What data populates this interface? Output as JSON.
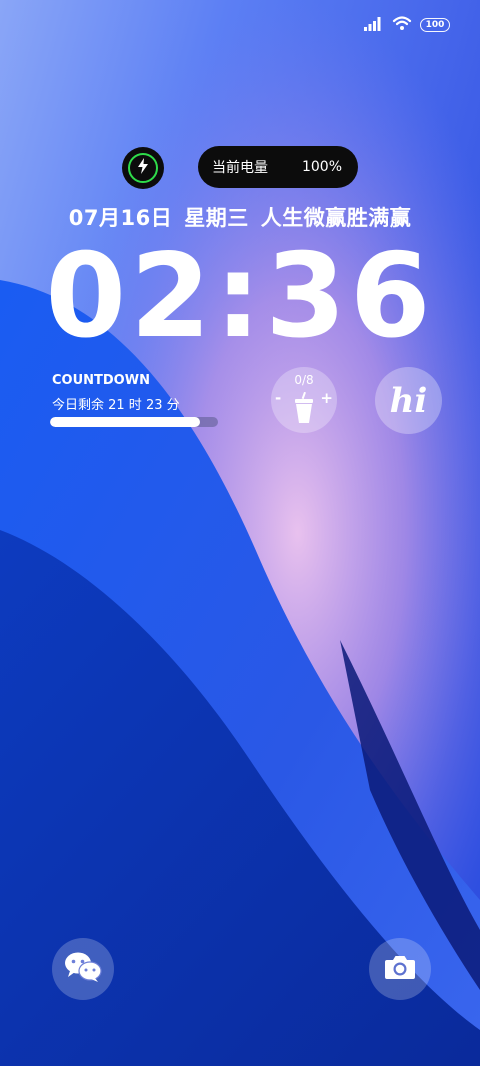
{
  "status_bar": {
    "battery_level": "100",
    "icons": [
      "signal-icon",
      "wifi-icon",
      "battery-icon"
    ]
  },
  "charging": {
    "icon": "lightning-icon",
    "ring_color": "#2fdc4a"
  },
  "battery_capsule": {
    "label": "当前电量",
    "value": "100%"
  },
  "lockscreen": {
    "date": "07月16日",
    "weekday": "星期三",
    "slogan": "人生微赢胜满赢",
    "time": "02:36"
  },
  "countdown": {
    "title": "COUNTDOWN",
    "remaining": "今日剩余 21 时 23 分",
    "progress": 0.89
  },
  "water_widget": {
    "count": "0/8",
    "minus": "-",
    "plus": "+",
    "icon": "cup-icon"
  },
  "hi_widget": {
    "text": "hi"
  },
  "shortcuts": {
    "left_icon": "wechat-icon",
    "right_icon": "camera-icon"
  },
  "colors": {
    "wallpaper_blue": "#1f47d8",
    "wallpaper_pink": "#e7b8ee",
    "wallpaper_deep": "#0b2a9e"
  }
}
